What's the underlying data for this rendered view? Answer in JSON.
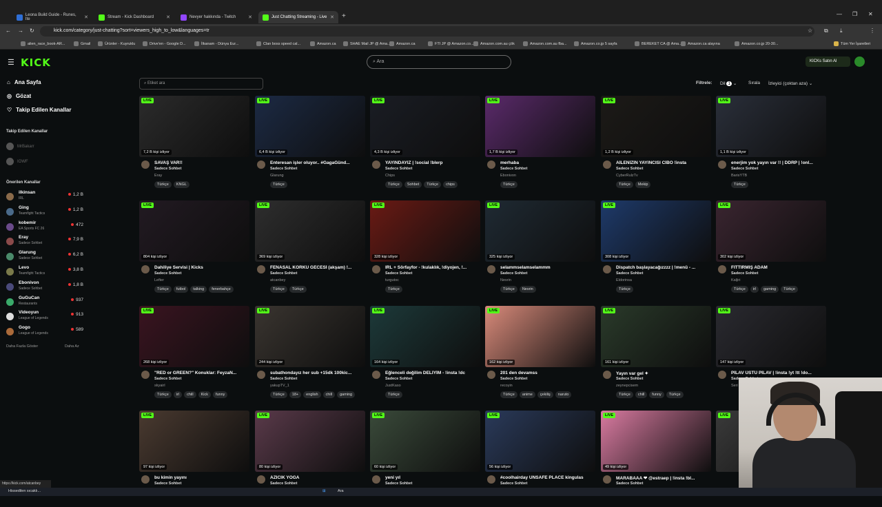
{
  "browser": {
    "tabs": [
      {
        "label": "Leona Build Guide - Runes, Ite",
        "color": "#2f6fd6"
      },
      {
        "label": "Stream - Kick Dashboard",
        "color": "#53fc18"
      },
      {
        "label": "Nevyer hakkında - Twitch",
        "color": "#9146ff"
      },
      {
        "label": "Just Chatting Streaming - Live",
        "color": "#53fc18"
      }
    ],
    "url": "kick.com/category/just-chatting?sort=viewers_high_to_low&languages=tr",
    "bookmarks": [
      "alien_race_book-AR...",
      "Gmail",
      "Ürünler - Kuyruklu",
      "Drive'en - Google D...",
      "İlkanam - Dünya Eur...",
      "Clan boss speed cal...",
      "Amazon.ca",
      "SHAE Mail JP @ Ama...",
      "Amazon.ca",
      "FTI JP @ Amazon.co...",
      "Amazon.com.au çök",
      "Amazon.com.au fba...",
      "Amazon.co.jp 5 sayfa",
      "BEREKET CA @ Ama...",
      "Amazon.ca alayına",
      "Amazon.co.jp 20-30..."
    ],
    "all_bookmarks": "Tüm Yer İşaretleri"
  },
  "kick": {
    "logo": "KICK",
    "search_placeholder": "Ara",
    "buy_ai": "KICKs Satın Al",
    "nav": [
      {
        "label": "Ana Sayfa",
        "icon": "home-icon"
      },
      {
        "label": "Gözat",
        "icon": "compass-icon"
      },
      {
        "label": "Takip Edilen Kanallar",
        "icon": "heart-icon"
      }
    ],
    "followed_header": "Takip Edilen Kanallar",
    "followed": [
      "MrBakarr",
      "IOWF"
    ],
    "recommended_header": "Önerilen Kanallar",
    "recommended": [
      {
        "name": "ilkinsan",
        "category": "IRL",
        "viewers": "1,2 B"
      },
      {
        "name": "Ging",
        "category": "Teamfight Tactics",
        "viewers": "1,2 B"
      },
      {
        "name": "kobemir",
        "category": "EA Sports FC 26",
        "viewers": "472"
      },
      {
        "name": "Eray",
        "category": "Sadece Sohbet",
        "viewers": "7,9 B"
      },
      {
        "name": "Glarung",
        "category": "Sadece Sohbet",
        "viewers": "6,2 B"
      },
      {
        "name": "Levo",
        "category": "Teamfight Tactics",
        "viewers": "3,8 B"
      },
      {
        "name": "Ebonivon",
        "category": "Sadece Sohbet",
        "viewers": "1,8 B"
      },
      {
        "name": "GuGuCan",
        "category": "Restaurants",
        "viewers": "937"
      },
      {
        "name": "Videoyun",
        "category": "League of Legends",
        "viewers": "913"
      },
      {
        "name": "Gogo",
        "category": "League of Legends",
        "viewers": "589"
      }
    ],
    "show_more": "Daha Fazla Göster",
    "show_less": "Daha Az",
    "tag_search": "Etiket ara",
    "filter_label": "Filtrele:",
    "language_label": "Dil",
    "language_count": "1",
    "sort_label": "Sırala",
    "sort_value": "İzleyici (çoktan aza)",
    "live_badge": "LIVE",
    "streams": [
      {
        "viewers": "7,2 B kişi izliyor",
        "title": "SAVAŞ VAR!!",
        "category": "Sadece Sohbet",
        "user": "Eray",
        "tags": [
          "Türkçe",
          "KNGL"
        ],
        "bg": "#2b2b2b"
      },
      {
        "viewers": "6,4 B kişi izliyor",
        "title": "Enteresan işler oluyor.. #GagaGünd...",
        "category": "Sadece Sohbet",
        "user": "Glarung",
        "tags": [
          "Türkçe"
        ],
        "bg": "#1c2a44"
      },
      {
        "viewers": "4,3 B kişi izliyor",
        "title": "YAYINDAYIZ | !social !blerp",
        "category": "Sadece Sohbet",
        "user": "Chips",
        "tags": [
          "Türkçe",
          "Sohbet",
          "Türkçe",
          "chips"
        ],
        "bg": "#1a1d24"
      },
      {
        "viewers": "1,7 B kişi izliyor",
        "title": "merhaba",
        "category": "Sadece Sohbet",
        "user": "Ebonivon",
        "tags": [
          "Türkçe"
        ],
        "bg": "#5a2a6a"
      },
      {
        "viewers": "1,2 B kişi izliyor",
        "title": "AİLENİZİN YAYINCISI CİBO !insta",
        "category": "Sadece Sohbet",
        "user": "CyberRulzTv",
        "tags": [
          "Türkçe",
          "Mekip"
        ],
        "bg": "#1c1a17"
      },
      {
        "viewers": "1,1 B kişi izliyor",
        "title": "enerjim yok yayın var !! | DDRP | !onl...",
        "category": "Sadece Sohbet",
        "user": "BarisYTB",
        "tags": [
          "Türkçe"
        ],
        "bg": "#2a2f3a"
      },
      {
        "viewers": "804 kişi izliyor",
        "title": "Dahiliye Servisi | Kicks",
        "category": "Sadece Sohbet",
        "user": "Lefter",
        "tags": [
          "Türkçe",
          "futbol",
          "talking",
          "fenerbahçe"
        ],
        "bg": "#221a22"
      },
      {
        "viewers": "369 kişi izliyor",
        "title": "FENASAL KORKU GECESİ (akşam) !...",
        "category": "Sadece Sohbet",
        "user": "atcanbey",
        "tags": [
          "Türkçe",
          "Türkçe"
        ],
        "bg": "#2e2e2e"
      },
      {
        "viewers": "328 kişi izliyor",
        "title": "IRL + Sörfayfor - !kulaklık, !diyojen, !...",
        "category": "Sadece Sohbet",
        "user": "turgutoc",
        "tags": [
          "Türkçe"
        ],
        "bg": "#6a1a14"
      },
      {
        "viewers": "325 kişi izliyor",
        "title": "selammselamselammm",
        "category": "Sadece Sohbet",
        "user": "Nesrin",
        "tags": [
          "Türkçe",
          "Nesrin"
        ],
        "bg": "#1f2a33"
      },
      {
        "viewers": "308 kişi izliyor",
        "title": "Dispatch başlayacağızzzz | !menü - ...",
        "category": "Sadece Sohbet",
        "user": "Eldorinsa",
        "tags": [
          "Türkçe"
        ],
        "bg": "#1e3a6a"
      },
      {
        "viewers": "302 kişi izliyor",
        "title": "FITTIRMIŞ ADAM",
        "category": "Sadece Sohbet",
        "user": "Kaljiri",
        "tags": [
          "Türkçe",
          "irl",
          "gaming",
          "Türkçe"
        ],
        "bg": "#3a2530"
      },
      {
        "viewers": "268 kişi izliyor",
        "title": "\"RED or GREEN?\" Konuklar: FeyzaN...",
        "category": "Sadece Sohbet",
        "user": "skyairl",
        "tags": [
          "Türkçe",
          "irl",
          "chill",
          "Kick",
          "funny"
        ],
        "bg": "#3a1420"
      },
      {
        "viewers": "244 kişi izliyor",
        "title": "subathondayız her sub +15dk 100kic...",
        "category": "Sadece Sohbet",
        "user": "yakupTV_1",
        "tags": [
          "Türkçe",
          "18+",
          "english",
          "chill",
          "gaming"
        ],
        "bg": "#3a3530"
      },
      {
        "viewers": "164 kişi izliyor",
        "title": "Eğlenceli değilim DELİYİM - !insta !dc",
        "category": "Sadece Sohbet",
        "user": "JustKaso",
        "tags": [
          "Türkçe"
        ],
        "bg": "#1d3a3a"
      },
      {
        "viewers": "162 kişi izliyor",
        "title": "201 den devamss",
        "category": "Sadece Sohbet",
        "user": "recoyin",
        "tags": [
          "Türkçe",
          "anime",
          "çekiliş",
          "naruto"
        ],
        "bg": "#d88a7a"
      },
      {
        "viewers": "161 kişi izliyor",
        "title": "Yayın var gel ✦",
        "category": "Sadece Sohbet",
        "user": "zeynepcisem",
        "tags": [
          "Türkçe",
          "chill",
          "funny",
          "Türkçe"
        ],
        "bg": "#2a3a2a"
      },
      {
        "viewers": "147 kişi izliyor",
        "title": "PİLAV ÜSTÜ PİLAV | !insta !yt !tt !do...",
        "category": "Sadece Sohbet",
        "user": "Seri",
        "tags": [],
        "bg": "#2a2a30"
      },
      {
        "viewers": "97 kişi izliyor",
        "title": "bu kimin yayını",
        "category": "Sadece Sohbet",
        "user": "",
        "tags": [],
        "bg": "#4a3a30"
      },
      {
        "viewers": "80 kişi izliyor",
        "title": "AZICIK YOGA",
        "category": "Sadece Sohbet",
        "user": "",
        "tags": [],
        "bg": "#5a3a4a"
      },
      {
        "viewers": "60 kişi izliyor",
        "title": "yeni yıl",
        "category": "Sadece Sohbet",
        "user": "",
        "tags": [],
        "bg": "#3a4a3a"
      },
      {
        "viewers": "56 kişi izliyor",
        "title": "#coolhairday UNSAFE PLACE kingulas",
        "category": "Sadece Sohbet",
        "user": "",
        "tags": [],
        "bg": "#2a3a5a"
      },
      {
        "viewers": "49 kişi izliyor",
        "title": "MARABAAA ❤ @estraep | !insta !bl...",
        "category": "Sadece Sohbet",
        "user": "",
        "tags": [],
        "bg": "#d87aa0"
      },
      {
        "viewers": "",
        "title": "",
        "category": "",
        "user": "",
        "tags": [],
        "bg": "#3a3a3a"
      }
    ]
  },
  "status_url": "https://kick.com/atcanbey",
  "taskbar": {
    "weather": "Hissedilen sıcaklı...",
    "search": "Ara"
  }
}
